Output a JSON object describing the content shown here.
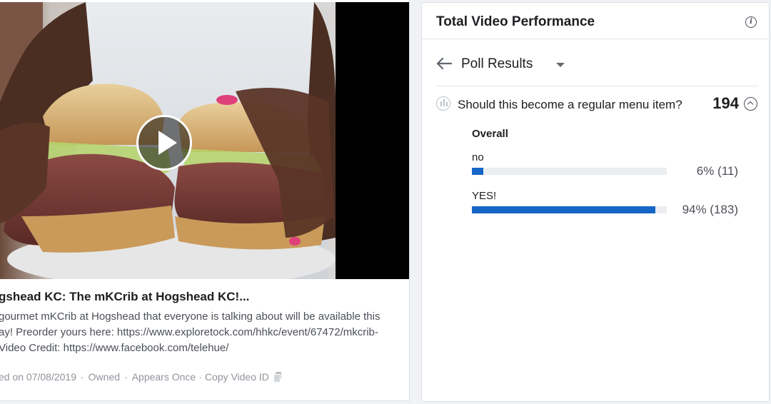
{
  "post": {
    "title": "gshead KC: The mKCrib at Hogshead KC!...",
    "description_lines": [
      "gourmet mKCrib at Hogshead that everyone is talking about will be available this",
      "ay! Preorder yours here: https://www.exploretock.com/hhkc/event/67472/mkcrib-",
      "Video Credit: https://www.facebook.com/telehue/"
    ],
    "meta": {
      "posted": "ed on 07/08/2019",
      "owned": "Owned",
      "appears": "Appears Once",
      "copy_id": "Copy Video ID"
    },
    "icons": {
      "play": "play-icon",
      "copy": "copy-icon"
    }
  },
  "panel": {
    "title": "Total Video Performance",
    "info_icon": "info-icon",
    "poll_selector": "Poll Results",
    "question": "Should this become a regular menu item?",
    "total_votes": "194",
    "overall_label": "Overall",
    "options": [
      {
        "label": "no",
        "percent": 6,
        "display": "6% (11)"
      },
      {
        "label": "YES!",
        "percent": 94,
        "display": "94% (183)"
      }
    ],
    "bar_color": "#1666c5",
    "track_color": "#ebedf0"
  }
}
